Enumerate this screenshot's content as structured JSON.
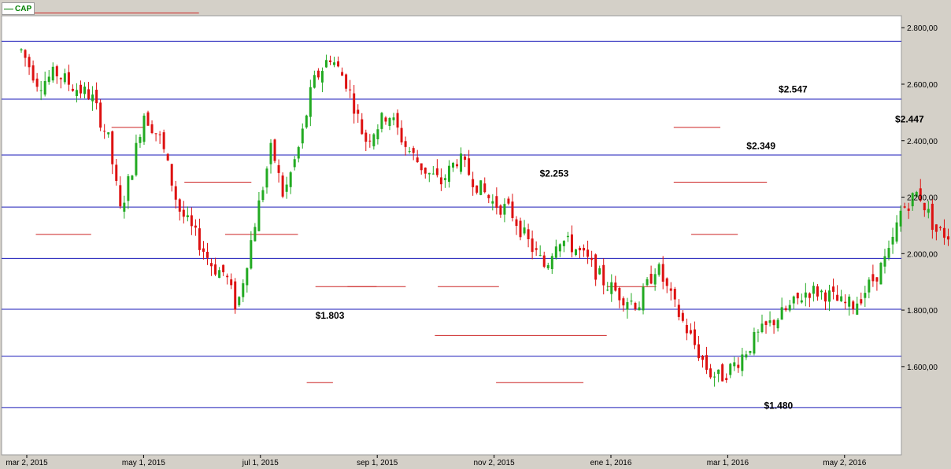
{
  "legend": {
    "ticker": "CAP",
    "color": "#008000"
  },
  "colors": {
    "up": "#22aa22",
    "down": "#dd1111",
    "hline": "#1a1ab8",
    "level": "#cc2222",
    "background": "#ffffff",
    "panel": "#d4d0c8"
  },
  "chart_data": {
    "type": "candlestick",
    "title": "",
    "legend": [
      "CAP"
    ],
    "x_ticks": [
      "mar 2, 2015",
      "may 1, 2015",
      "jul 1, 2015",
      "sep 1, 2015",
      "nov 2, 2015",
      "ene 1, 2016",
      "mar 1, 2016",
      "may 2, 2016"
    ],
    "y_ticks": [
      "1.600,00",
      "1.800,00",
      "2.000,00",
      "2.200,00",
      "2.400,00",
      "2.600,00",
      "2.800,00"
    ],
    "y_tick_values": [
      1600,
      1800,
      2000,
      2200,
      2400,
      2600,
      2800
    ],
    "ylim": [
      1370,
      2910
    ],
    "x_range_months": [
      0,
      15.7
    ],
    "grid": "horizontal",
    "horizontal_lines": [
      1455,
      1637,
      1803,
      1983,
      2165,
      2349,
      2547,
      2752
    ],
    "annotations": [
      {
        "text": "$1.803",
        "m": 5.05,
        "y": 1770
      },
      {
        "text": "$2.253",
        "m": 8.9,
        "y": 2273
      },
      {
        "text": "$2.547",
        "m": 13.0,
        "y": 2570
      },
      {
        "text": "$2.349",
        "m": 12.45,
        "y": 2370
      },
      {
        "text": "$2.447",
        "m": 15.0,
        "y": 2465
      },
      {
        "text": "$1.480",
        "m": 12.75,
        "y": 1450
      }
    ],
    "levels": [
      {
        "y": 2852,
        "m0": -0.1,
        "m1": 6.1
      },
      {
        "y": 2447,
        "m0": 3.1,
        "m1": 4.2
      },
      {
        "y": 2253,
        "m0": 5.6,
        "m1": 7.9
      },
      {
        "y": 2068,
        "m0": 0.5,
        "m1": 2.4
      },
      {
        "y": 2068,
        "m0": 7.0,
        "m1": 9.5
      },
      {
        "y": 1883,
        "m0": 10.1,
        "m1": 12.2
      },
      {
        "y": 1883,
        "m0": 11.2,
        "m1": 13.2
      },
      {
        "y": 1883,
        "m0": 14.3,
        "m1": 16.4
      },
      {
        "y": 1710,
        "m0": 14.2,
        "m1": 20.1
      },
      {
        "y": 1543,
        "m0": 9.8,
        "m1": 10.7
      },
      {
        "y": 1543,
        "m0": 16.3,
        "m1": 19.3
      },
      {
        "y": 1883,
        "m0": 20.1,
        "m1": 21.8
      },
      {
        "y": 2447,
        "m0": 22.4,
        "m1": 24.0
      },
      {
        "y": 2253,
        "m0": 22.4,
        "m1": 25.6
      },
      {
        "y": 2068,
        "m0": 23.0,
        "m1": 24.6
      }
    ],
    "series": [
      {
        "name": "CAP",
        "points": [
          [
            0.0,
            2720
          ],
          [
            0.3,
            2600
          ],
          [
            0.6,
            2640
          ],
          [
            0.9,
            2590
          ],
          [
            1.2,
            2560
          ],
          [
            1.5,
            2400
          ],
          [
            1.7,
            2150
          ],
          [
            1.9,
            2300
          ],
          [
            2.1,
            2500
          ],
          [
            2.4,
            2400
          ],
          [
            2.7,
            2160
          ],
          [
            3.0,
            2060
          ],
          [
            3.3,
            1950
          ],
          [
            3.5,
            1930
          ],
          [
            3.7,
            1803
          ],
          [
            4.0,
            2100
          ],
          [
            4.3,
            2380
          ],
          [
            4.5,
            2200
          ],
          [
            4.8,
            2400
          ],
          [
            5.0,
            2600
          ],
          [
            5.3,
            2700
          ],
          [
            5.6,
            2600
          ],
          [
            5.9,
            2400
          ],
          [
            6.1,
            2450
          ],
          [
            6.3,
            2500
          ],
          [
            6.6,
            2380
          ],
          [
            6.9,
            2300
          ],
          [
            7.2,
            2250
          ],
          [
            7.5,
            2340
          ],
          [
            7.8,
            2250
          ],
          [
            8.1,
            2180
          ],
          [
            8.4,
            2150
          ],
          [
            8.7,
            2040
          ],
          [
            9.0,
            1950
          ],
          [
            9.2,
            2060
          ],
          [
            9.5,
            2020
          ],
          [
            9.7,
            1980
          ],
          [
            10.0,
            1900
          ],
          [
            10.3,
            1850
          ],
          [
            10.6,
            1820
          ],
          [
            10.9,
            1960
          ],
          [
            11.2,
            1820
          ],
          [
            11.5,
            1700
          ],
          [
            11.8,
            1580
          ],
          [
            12.0,
            1560
          ],
          [
            12.3,
            1620
          ],
          [
            12.6,
            1700
          ],
          [
            12.9,
            1760
          ],
          [
            13.2,
            1810
          ],
          [
            13.5,
            1870
          ],
          [
            13.8,
            1860
          ],
          [
            14.1,
            1820
          ],
          [
            14.3,
            1820
          ],
          [
            14.6,
            1900
          ],
          [
            14.9,
            2000
          ],
          [
            15.1,
            2150
          ],
          [
            15.4,
            2220
          ],
          [
            15.7,
            2080
          ],
          [
            16.0,
            2060
          ],
          [
            16.3,
            1980
          ],
          [
            16.6,
            1900
          ],
          [
            16.9,
            1850
          ],
          [
            17.2,
            1900
          ],
          [
            17.5,
            1930
          ],
          [
            17.8,
            1940
          ],
          [
            18.1,
            1880
          ],
          [
            18.4,
            1870
          ],
          [
            18.7,
            1840
          ],
          [
            19.0,
            1720
          ],
          [
            19.3,
            1660
          ],
          [
            19.6,
            1620
          ],
          [
            19.9,
            1680
          ],
          [
            20.2,
            1700
          ],
          [
            20.5,
            1650
          ],
          [
            20.8,
            1620
          ],
          [
            21.1,
            1560
          ],
          [
            21.4,
            1480
          ],
          [
            21.7,
            1470
          ],
          [
            22.0,
            1480
          ],
          [
            22.3,
            1500
          ],
          [
            22.6,
            1560
          ],
          [
            22.9,
            1580
          ],
          [
            23.2,
            1640
          ],
          [
            23.5,
            1660
          ],
          [
            23.8,
            1690
          ],
          [
            24.1,
            1860
          ],
          [
            24.4,
            2000
          ],
          [
            24.7,
            1980
          ],
          [
            25.0,
            2060
          ],
          [
            25.3,
            2040
          ],
          [
            25.6,
            2000
          ],
          [
            25.9,
            1990
          ],
          [
            26.2,
            2040
          ],
          [
            26.5,
            2100
          ],
          [
            26.8,
            2220
          ],
          [
            27.1,
            2420
          ],
          [
            27.4,
            2480
          ],
          [
            27.7,
            2440
          ],
          [
            28.0,
            2350
          ],
          [
            28.3,
            2280
          ],
          [
            28.6,
            2230
          ],
          [
            28.9,
            2160
          ],
          [
            29.2,
            2100
          ],
          [
            29.5,
            2300
          ],
          [
            29.8,
            2349
          ]
        ]
      }
    ]
  }
}
